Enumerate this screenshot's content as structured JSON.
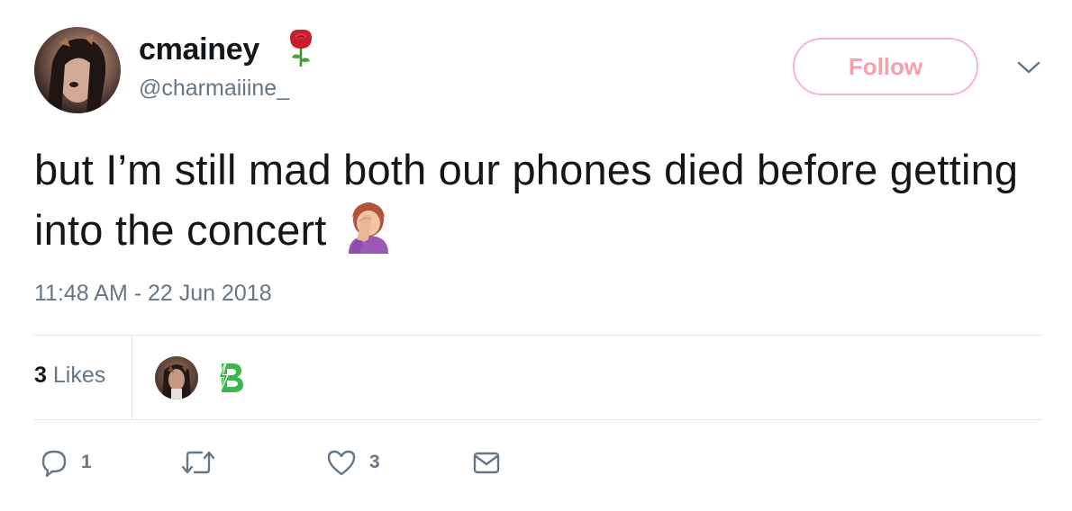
{
  "user": {
    "display_name": "cmainey",
    "handle": "@charmaiiine_",
    "name_emoji": "rose-icon"
  },
  "header": {
    "follow_label": "Follow",
    "menu_icon": "chevron-down-icon"
  },
  "tweet": {
    "text": "but I’m still mad both our phones died before getting into the concert",
    "trailing_emoji": "woman-facepalming-icon",
    "timestamp": "11:48 AM - 22 Jun 2018"
  },
  "stats": {
    "likes_count": "3",
    "likes_label": "Likes"
  },
  "actions": {
    "reply_count": "1",
    "retweet_count": "",
    "like_count": "3"
  },
  "colors": {
    "follow_border": "#f4b9c2",
    "follow_text": "#f4a0ad",
    "secondary_text": "#657786",
    "primary_text": "#14171a",
    "divider": "#e1e8ed",
    "liker_logo_green": "#3cb54a"
  }
}
